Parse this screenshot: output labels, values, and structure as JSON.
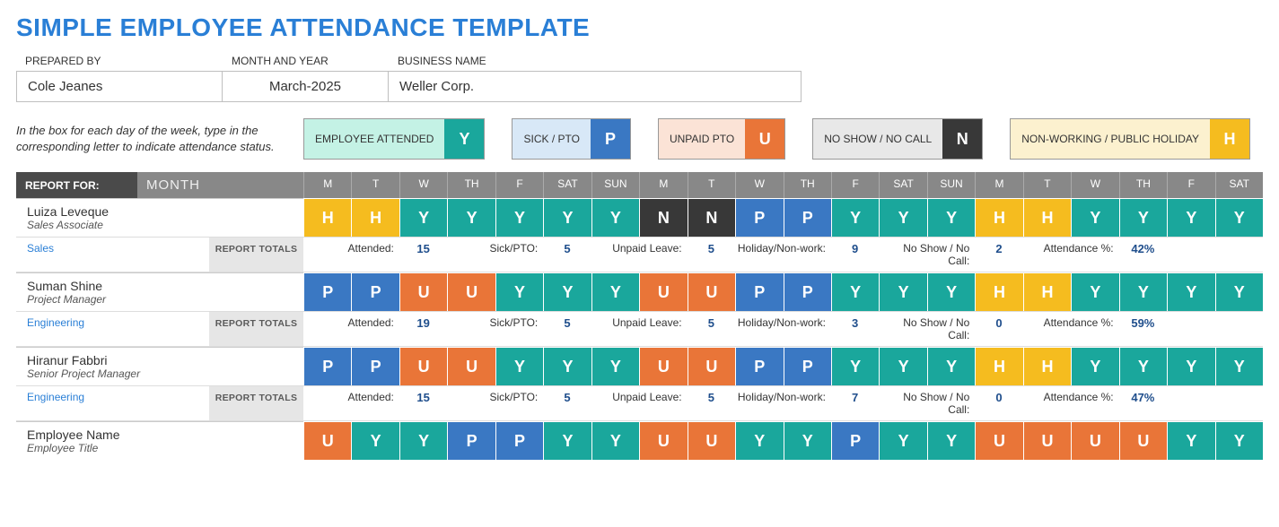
{
  "title": "SIMPLE EMPLOYEE ATTENDANCE TEMPLATE",
  "meta": {
    "prepared_by_label": "PREPARED BY",
    "prepared_by": "Cole Jeanes",
    "month_year_label": "MONTH AND YEAR",
    "month_year": "March-2025",
    "business_label": "BUSINESS NAME",
    "business": "Weller Corp."
  },
  "legend": {
    "instructions": "In the box for each day of the week, type in the corresponding letter to indicate attendance status.",
    "items": [
      {
        "label": "EMPLOYEE ATTENDED",
        "code": "Y"
      },
      {
        "label": "SICK / PTO",
        "code": "P"
      },
      {
        "label": "UNPAID PTO",
        "code": "U"
      },
      {
        "label": "NO SHOW / NO CALL",
        "code": "N"
      },
      {
        "label": "NON-WORKING / PUBLIC HOLIDAY",
        "code": "H"
      }
    ]
  },
  "report_for_label": "REPORT FOR:",
  "month_header": "MONTH",
  "day_headers": [
    "M",
    "T",
    "W",
    "TH",
    "F",
    "SAT",
    "SUN",
    "M",
    "T",
    "W",
    "TH",
    "F",
    "SAT",
    "SUN",
    "M",
    "T",
    "W",
    "TH",
    "F",
    "SAT"
  ],
  "report_totals_label": "REPORT TOTALS",
  "totals_labels": {
    "attended": "Attended:",
    "sick": "Sick/PTO:",
    "unpaid": "Unpaid Leave:",
    "holiday": "Holiday/Non-work:",
    "noshow": "No Show / No Call:",
    "pct": "Attendance %:"
  },
  "employees": [
    {
      "name": "Luiza Leveque",
      "title": "Sales Associate",
      "department": "Sales",
      "days": [
        "H",
        "H",
        "Y",
        "Y",
        "Y",
        "Y",
        "Y",
        "N",
        "N",
        "P",
        "P",
        "Y",
        "Y",
        "Y",
        "H",
        "H",
        "Y",
        "Y",
        "Y",
        "Y"
      ],
      "totals": {
        "attended": "15",
        "sick": "5",
        "unpaid": "5",
        "holiday": "9",
        "noshow": "2",
        "pct": "42%"
      }
    },
    {
      "name": "Suman Shine",
      "title": "Project Manager",
      "department": "Engineering",
      "days": [
        "P",
        "P",
        "U",
        "U",
        "Y",
        "Y",
        "Y",
        "U",
        "U",
        "P",
        "P",
        "Y",
        "Y",
        "Y",
        "H",
        "H",
        "Y",
        "Y",
        "Y",
        "Y"
      ],
      "totals": {
        "attended": "19",
        "sick": "5",
        "unpaid": "5",
        "holiday": "3",
        "noshow": "0",
        "pct": "59%"
      }
    },
    {
      "name": "Hiranur Fabbri",
      "title": "Senior Project Manager",
      "department": "Engineering",
      "days": [
        "P",
        "P",
        "U",
        "U",
        "Y",
        "Y",
        "Y",
        "U",
        "U",
        "P",
        "P",
        "Y",
        "Y",
        "Y",
        "H",
        "H",
        "Y",
        "Y",
        "Y",
        "Y"
      ],
      "totals": {
        "attended": "15",
        "sick": "5",
        "unpaid": "5",
        "holiday": "7",
        "noshow": "0",
        "pct": "47%"
      }
    },
    {
      "name": "Employee Name",
      "title": "Employee Title",
      "department": "",
      "days": [
        "U",
        "Y",
        "Y",
        "P",
        "P",
        "Y",
        "Y",
        "U",
        "U",
        "Y",
        "Y",
        "P",
        "Y",
        "Y",
        "U",
        "U",
        "U",
        "U",
        "Y",
        "Y"
      ],
      "totals": null
    }
  ]
}
